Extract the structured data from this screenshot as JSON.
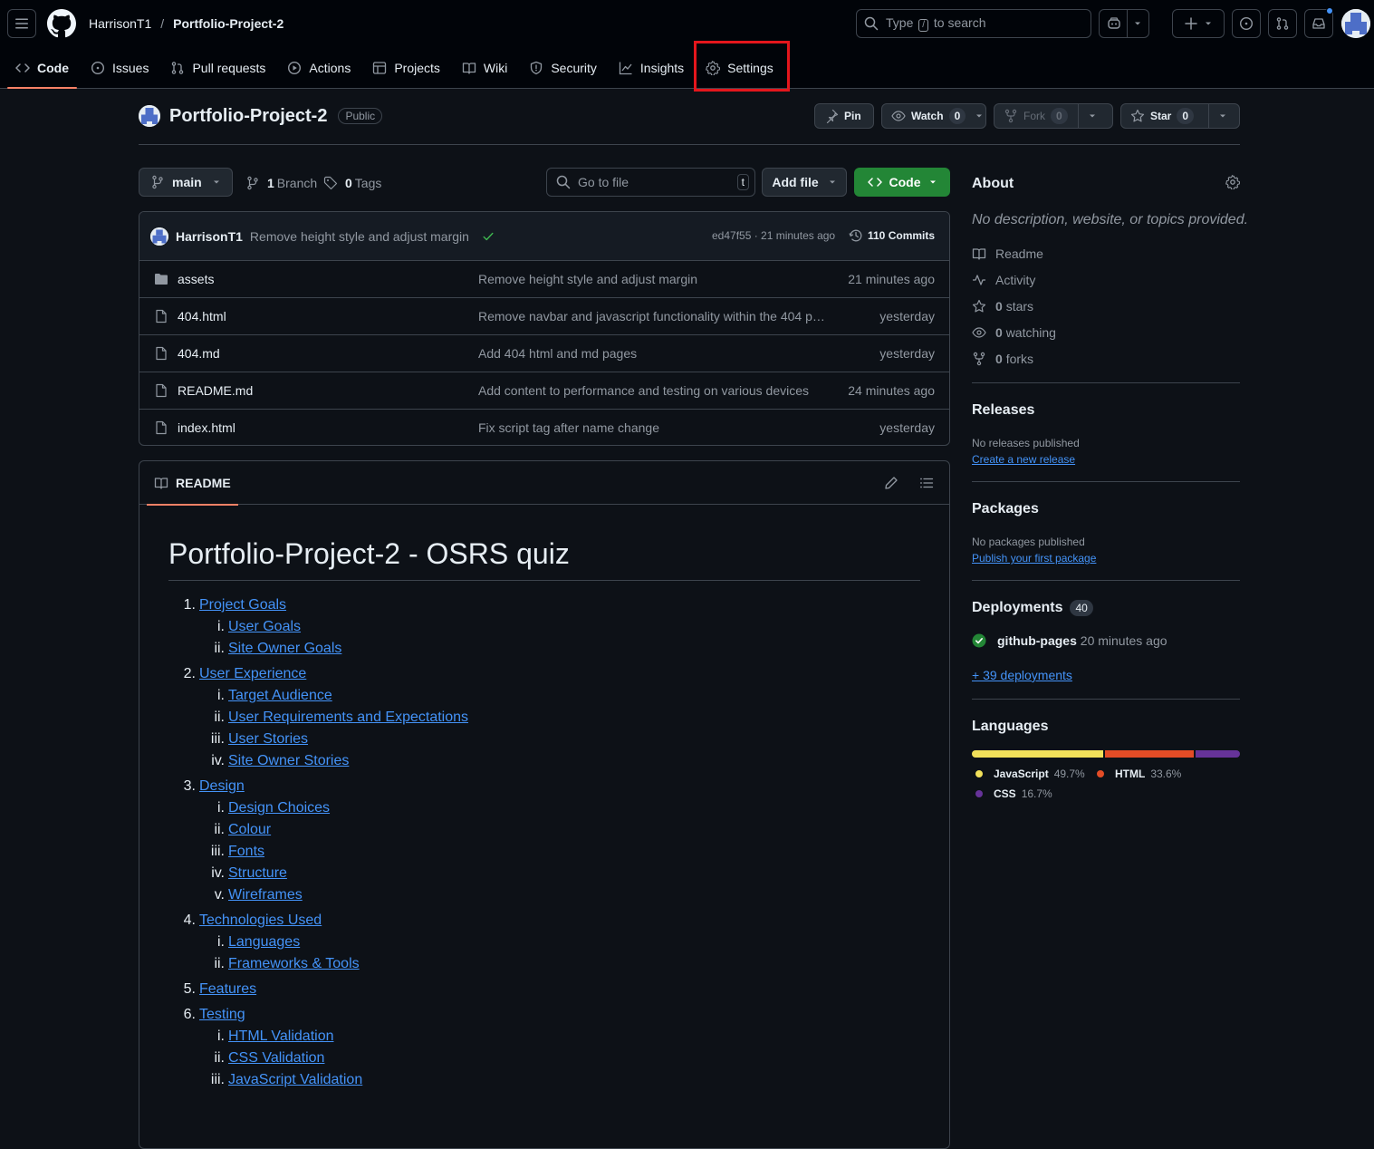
{
  "header": {
    "owner": "HarrisonT1",
    "separator": "/",
    "repo": "Portfolio-Project-2",
    "search_prefix": "Type",
    "search_key": "/",
    "search_suffix": "to search"
  },
  "tabs": [
    {
      "label": "Code",
      "icon": "code-icon"
    },
    {
      "label": "Issues",
      "icon": "issue-icon"
    },
    {
      "label": "Pull requests",
      "icon": "pull-request-icon"
    },
    {
      "label": "Actions",
      "icon": "play-icon"
    },
    {
      "label": "Projects",
      "icon": "table-icon"
    },
    {
      "label": "Wiki",
      "icon": "book-icon"
    },
    {
      "label": "Security",
      "icon": "shield-icon"
    },
    {
      "label": "Insights",
      "icon": "graph-icon"
    },
    {
      "label": "Settings",
      "icon": "gear-icon"
    }
  ],
  "repo_header": {
    "name": "Portfolio-Project-2",
    "visibility": "Public",
    "pin": "Pin",
    "watch": "Watch",
    "watch_count": "0",
    "fork": "Fork",
    "fork_count": "0",
    "star": "Star",
    "star_count": "0"
  },
  "file_nav": {
    "branch": "main",
    "branch_count": "1",
    "branch_label": "Branch",
    "tag_count": "0",
    "tag_label": "Tags",
    "goto_placeholder": "Go to file",
    "goto_key": "t",
    "add_file": "Add file",
    "code": "Code"
  },
  "latest_commit": {
    "author": "HarrisonT1",
    "message": "Remove height style and adjust margin",
    "sha_time": "ed47f55 · 21 minutes ago",
    "commits": "110 Commits"
  },
  "files": [
    {
      "name": "assets",
      "type": "folder",
      "message": "Remove height style and adjust margin",
      "date": "21 minutes ago"
    },
    {
      "name": "404.html",
      "type": "file",
      "message": "Remove navbar and javascript functionality within the 404 page",
      "date": "yesterday"
    },
    {
      "name": "404.md",
      "type": "file",
      "message": "Add 404 html and md pages",
      "date": "yesterday"
    },
    {
      "name": "README.md",
      "type": "file",
      "message": "Add content to performance and testing on various devices",
      "date": "24 minutes ago"
    },
    {
      "name": "index.html",
      "type": "file",
      "message": "Fix script tag after name change",
      "date": "yesterday"
    }
  ],
  "readme": {
    "tab": "README",
    "title": "Portfolio-Project-2 - OSRS quiz",
    "toc": [
      {
        "num": "1.",
        "label": "Project Goals",
        "level": 0
      },
      {
        "num": "i.",
        "label": "User Goals",
        "level": 1
      },
      {
        "num": "ii.",
        "label": "Site Owner Goals",
        "level": 1
      },
      {
        "num": "2.",
        "label": "User Experience",
        "level": 0
      },
      {
        "num": "i.",
        "label": "Target Audience",
        "level": 1
      },
      {
        "num": "ii.",
        "label": "User Requirements and Expectations",
        "level": 1
      },
      {
        "num": "iii.",
        "label": "User Stories",
        "level": 1
      },
      {
        "num": "iv.",
        "label": "Site Owner Stories",
        "level": 1
      },
      {
        "num": "3.",
        "label": "Design",
        "level": 0
      },
      {
        "num": "i.",
        "label": "Design Choices",
        "level": 1
      },
      {
        "num": "ii.",
        "label": "Colour",
        "level": 1
      },
      {
        "num": "iii.",
        "label": "Fonts",
        "level": 1
      },
      {
        "num": "iv.",
        "label": "Structure",
        "level": 1
      },
      {
        "num": "v.",
        "label": "Wireframes",
        "level": 1
      },
      {
        "num": "4.",
        "label": "Technologies Used",
        "level": 0
      },
      {
        "num": "i.",
        "label": "Languages",
        "level": 1
      },
      {
        "num": "ii.",
        "label": "Frameworks & Tools",
        "level": 1
      },
      {
        "num": "5.",
        "label": "Features",
        "level": 0
      },
      {
        "num": "6.",
        "label": "Testing",
        "level": 0
      },
      {
        "num": "i.",
        "label": "HTML Validation",
        "level": 1
      },
      {
        "num": "ii.",
        "label": "CSS Validation",
        "level": 1
      },
      {
        "num": "iii.",
        "label": "JavaScript Validation",
        "level": 1
      }
    ]
  },
  "sidebar": {
    "about_title": "About",
    "about_desc": "No description, website, or topics provided.",
    "items": [
      {
        "icon": "book-icon",
        "bold": "",
        "label": "Readme"
      },
      {
        "icon": "pulse-icon",
        "bold": "",
        "label": "Activity"
      },
      {
        "icon": "star-icon",
        "bold": "0",
        "label": "stars"
      },
      {
        "icon": "eye-icon",
        "bold": "0",
        "label": "watching"
      },
      {
        "icon": "fork-icon",
        "bold": "0",
        "label": "forks"
      }
    ],
    "releases_title": "Releases",
    "releases_text": "No releases published",
    "releases_link": "Create a new release",
    "packages_title": "Packages",
    "packages_text": "No packages published",
    "packages_link": "Publish your first package",
    "deployments_title": "Deployments",
    "deployments_count": "40",
    "deployment_name": "github-pages",
    "deployment_time": "20 minutes ago",
    "deployments_link": "+ 39 deployments",
    "languages_title": "Languages",
    "languages": [
      {
        "name": "JavaScript",
        "pct": "49.7%",
        "value": 49.7,
        "color": "#f1e05a"
      },
      {
        "name": "HTML",
        "pct": "33.6%",
        "value": 33.6,
        "color": "#e34c26"
      },
      {
        "name": "CSS",
        "pct": "16.7%",
        "value": 16.7,
        "color": "#663399"
      }
    ]
  }
}
